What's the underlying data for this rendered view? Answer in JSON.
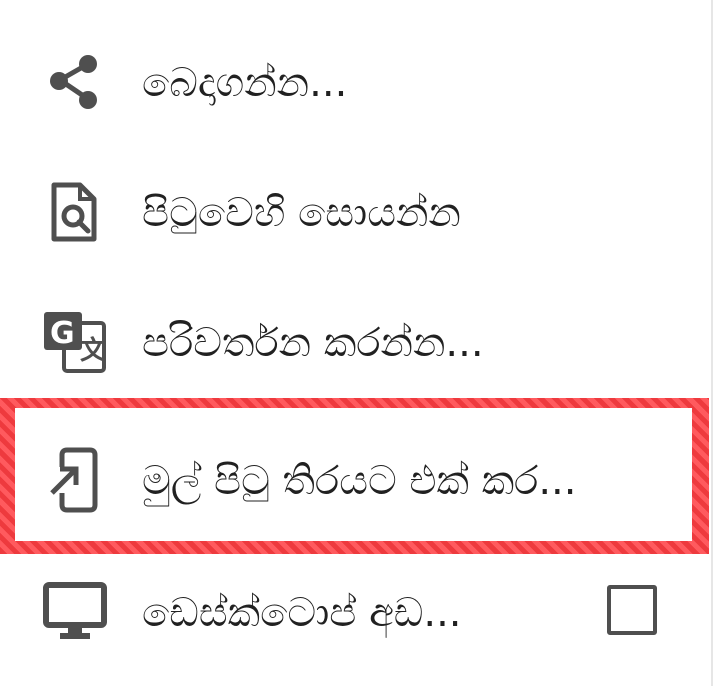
{
  "menu": {
    "items": [
      {
        "label": "බෙදාගන්න...",
        "icon": "share-icon"
      },
      {
        "label": "පිටුවෙහි සොයන්න",
        "icon": "find-in-page-icon"
      },
      {
        "label": "පරිවර්තන කරන්න...",
        "icon": "translate-icon"
      },
      {
        "label": "මුල් පිටු තිරයට එක් කර...",
        "icon": "add-to-home-screen-icon"
      },
      {
        "label": "ඩෙස්ක්ටොප් අඩ...",
        "icon": "desktop-icon",
        "checkbox_checked": false
      }
    ]
  },
  "colors": {
    "icon": "#4f4f4f",
    "text": "#212121",
    "highlight": "#ee3a3e"
  }
}
